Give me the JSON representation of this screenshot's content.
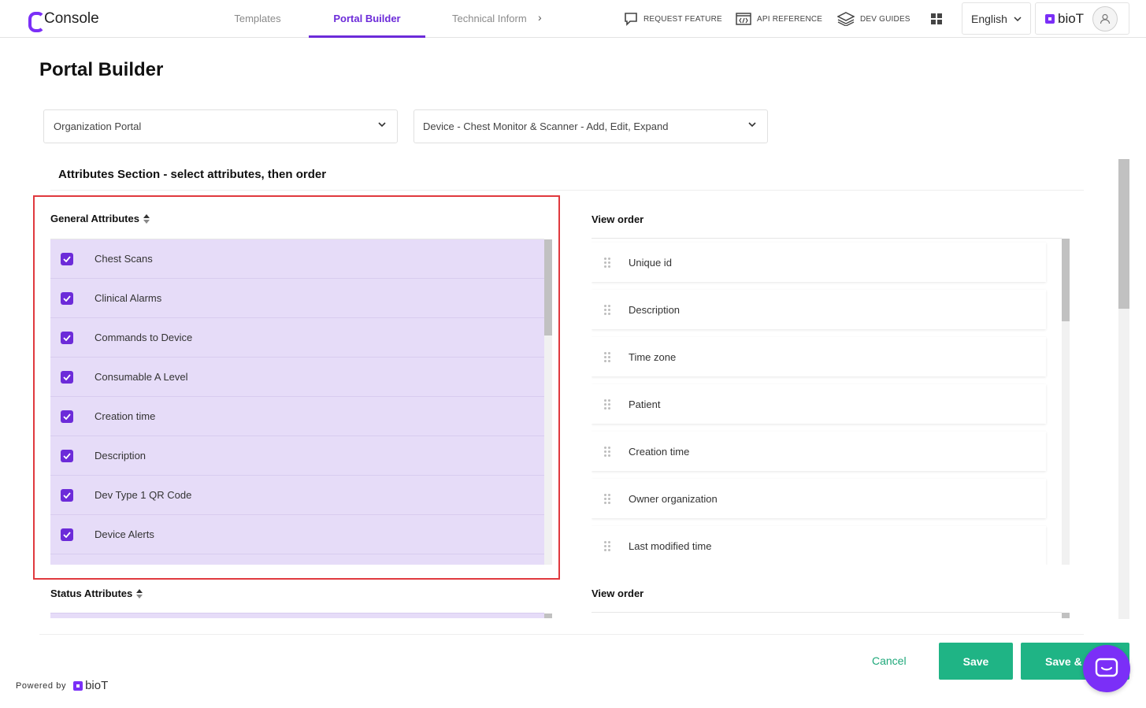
{
  "app": {
    "logo_text": "Console"
  },
  "nav": {
    "tabs": [
      {
        "label": "Templates"
      },
      {
        "label": "Portal Builder"
      },
      {
        "label": "Technical Inform"
      }
    ],
    "next_arrow": "›"
  },
  "toolbar": {
    "request_feature": "REQUEST FEATURE",
    "api_reference": "API REFERENCE",
    "dev_guides": "DEV GUIDES",
    "language": "English",
    "brand": "bioT"
  },
  "page": {
    "title": "Portal Builder"
  },
  "selectors": {
    "portal": "Organization Portal",
    "template": "Device - Chest Monitor & Scanner - Add, Edit, Expand"
  },
  "attributes_section": {
    "title": "Attributes Section - select attributes, then order",
    "general": {
      "heading": "General Attributes",
      "items": [
        {
          "label": "Chest Scans",
          "checked": true
        },
        {
          "label": "Clinical Alarms",
          "checked": true
        },
        {
          "label": "Commands to Device",
          "checked": true
        },
        {
          "label": "Consumable A Level",
          "checked": true
        },
        {
          "label": "Creation time",
          "checked": true
        },
        {
          "label": "Description",
          "checked": true
        },
        {
          "label": "Dev Type 1 QR Code",
          "checked": true
        },
        {
          "label": "Device Alerts",
          "checked": true
        }
      ],
      "view_order_heading": "View order",
      "view_order": [
        "Unique id",
        "Description",
        "Time zone",
        "Patient",
        "Creation time",
        "Owner organization",
        "Last modified time"
      ]
    },
    "status": {
      "heading": "Status Attributes",
      "view_order_heading": "View order"
    }
  },
  "footer": {
    "cancel": "Cancel",
    "save": "Save",
    "save_and": "Save & N",
    "powered_by": "Powered by",
    "powered_brand": "bioT"
  },
  "colors": {
    "accent": "#6c2bd9",
    "list_bg": "#e6dcf8",
    "primary_button": "#1fb485",
    "highlight_border": "#e0393e"
  }
}
